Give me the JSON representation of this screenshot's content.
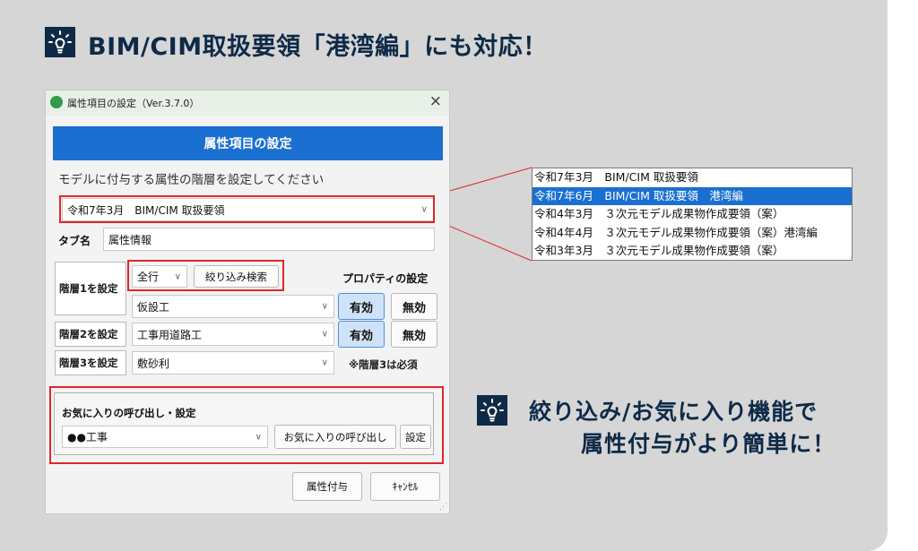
{
  "headline": {
    "text": "BIM/CIM取扱要領「港湾編」にも対応！",
    "icon": "lightbulb-icon"
  },
  "callout": {
    "line1": "絞り込み/お気に入り機能で",
    "line2": "属性付与がより簡単に！",
    "icon": "lightbulb-icon"
  },
  "window": {
    "title": "属性項目の設定（Ver.3.7.0）",
    "close": "×",
    "banner": "属性項目の設定",
    "instruction": "モデルに付与する属性の階層を設定してください",
    "guideline_value": "令和7年3月　BIM/CIM 取扱要領",
    "tab_label": "タブ名",
    "tab_value": "属性情報",
    "level1_label": "階層1を設定",
    "level2_label": "階層2を設定",
    "level3_label": "階層3を設定",
    "filter_value": "全行",
    "filter_button": "絞り込み検索",
    "property_title": "プロパティの設定",
    "level1_value": "仮設工",
    "level2_value": "工事用道路工",
    "level3_value": "敷砂利",
    "enable": "有効",
    "disable": "無効",
    "level3_note": "※階層3は必須",
    "fav_title": "お気に入りの呼び出し・設定",
    "fav_value": "●●工事",
    "fav_call_button": "お気に入りの呼び出し",
    "fav_set_button": "設定",
    "apply_button": "属性付与",
    "cancel_button": "ｷｬﾝｾﾙ"
  },
  "dropdown_list": [
    "令和7年3月　BIM/CIM 取扱要領",
    "令和7年6月　BIM/CIM 取扱要領　港湾編",
    "令和4年3月　３次元モデル成果物作成要領（案）",
    "令和4年4月　３次元モデル成果物作成要領（案）港湾編",
    "令和3年3月　３次元モデル成果物作成要領（案）"
  ],
  "selected_index": 1,
  "colors": {
    "accent": "#1a6fd1",
    "navy": "#0e2a47",
    "highlight": "#e0262d",
    "panel": "#d6d6d6"
  }
}
